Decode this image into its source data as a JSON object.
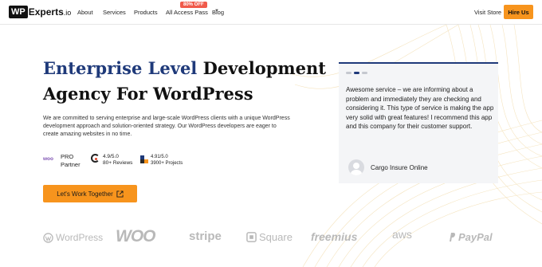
{
  "header": {
    "logo_box": "WP",
    "logo_text": "Experts",
    "logo_tld": ".io",
    "nav": [
      {
        "label": "About"
      },
      {
        "label": "Services"
      },
      {
        "label": "Products"
      },
      {
        "label": "All Access Pass",
        "badge": "80% OFF"
      },
      {
        "label": "Blog"
      }
    ],
    "visit_store": "Visit Store",
    "hire_us": "Hire Us"
  },
  "hero": {
    "title_accent": "Enterprise Level",
    "title_rest_line1": " Development",
    "title_line2": "Agency For WordPress",
    "description": "We are committed to serving enterprise and large-scale WordPress clients with a unique WordPress development approach and solution-oriented strategy. Our WordPress developers are eager to create amazing websites in no time.",
    "woo_badge": "woo",
    "partner_line1": "PRO",
    "partner_line2": "Partner",
    "rating1_score": "4.9/5.0",
    "rating1_count": "80+ Reviews",
    "rating2_score": "4.91/5.0",
    "rating2_count": "3900+ Projects",
    "cta_label": "Let's Work Together"
  },
  "testimonial": {
    "dots": 3,
    "active_dot": 1,
    "quote": "Awesome service – we are informing about a problem and immediately they are checking and considering it. This type of service is making the app very solid with great features! I recommend this app and this company for their customer support.",
    "author": "Cargo Insure Online"
  },
  "clients": [
    "WordPress",
    "WOO",
    "stripe",
    "Square",
    "freemius",
    "aws",
    "PayPal"
  ],
  "colors": {
    "accent_orange": "#f7941d",
    "brand_navy": "#1f3a7a",
    "badge_red": "#f05a4a",
    "logo_gray": "#b9b9b9"
  },
  "icons": [
    "external-link-icon",
    "clutch-icon",
    "codeable-icon",
    "avatar-icon",
    "chevron-down-icon"
  ]
}
